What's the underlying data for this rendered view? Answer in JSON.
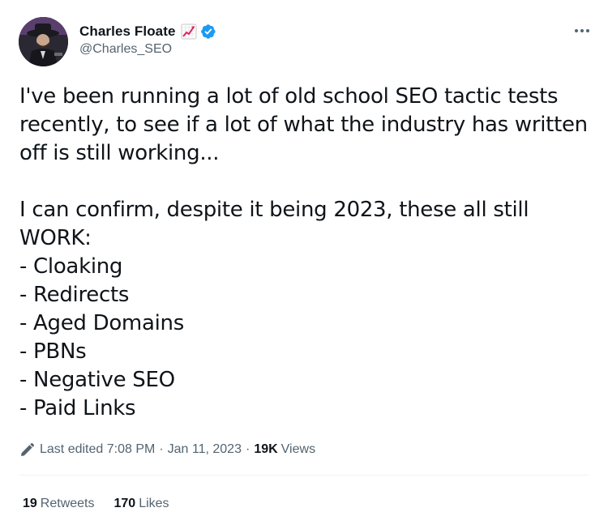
{
  "author": {
    "display_name": "Charles Floate",
    "handle": "@Charles_SEO",
    "name_emoji": "chart-increasing-emoji",
    "verified_badge": "verified-icon"
  },
  "tweet": {
    "paragraph1": [
      "I've been running a lot of old school SEO tactic tests",
      "recently, to see if a lot of what the industry has written",
      "off is still working..."
    ],
    "paragraph2": [
      "I can confirm, despite it being 2023, these all still",
      "WORK:",
      "- Cloaking",
      "- Redirects",
      "- Aged Domains",
      "- PBNs",
      "- Negative SEO",
      "- Paid Links"
    ]
  },
  "meta": {
    "edited_label": "Last edited 7:08 PM",
    "separator": "·",
    "date": "Jan 11, 2023",
    "views_count": "19K",
    "views_label": "Views"
  },
  "stats": {
    "retweets_count": "19",
    "retweets_label": "Retweets",
    "likes_count": "170",
    "likes_label": "Likes"
  },
  "colors": {
    "text": "#0f1419",
    "secondary": "#536471",
    "verified_blue": "#1d9bf0",
    "divider": "#eff3f4"
  }
}
